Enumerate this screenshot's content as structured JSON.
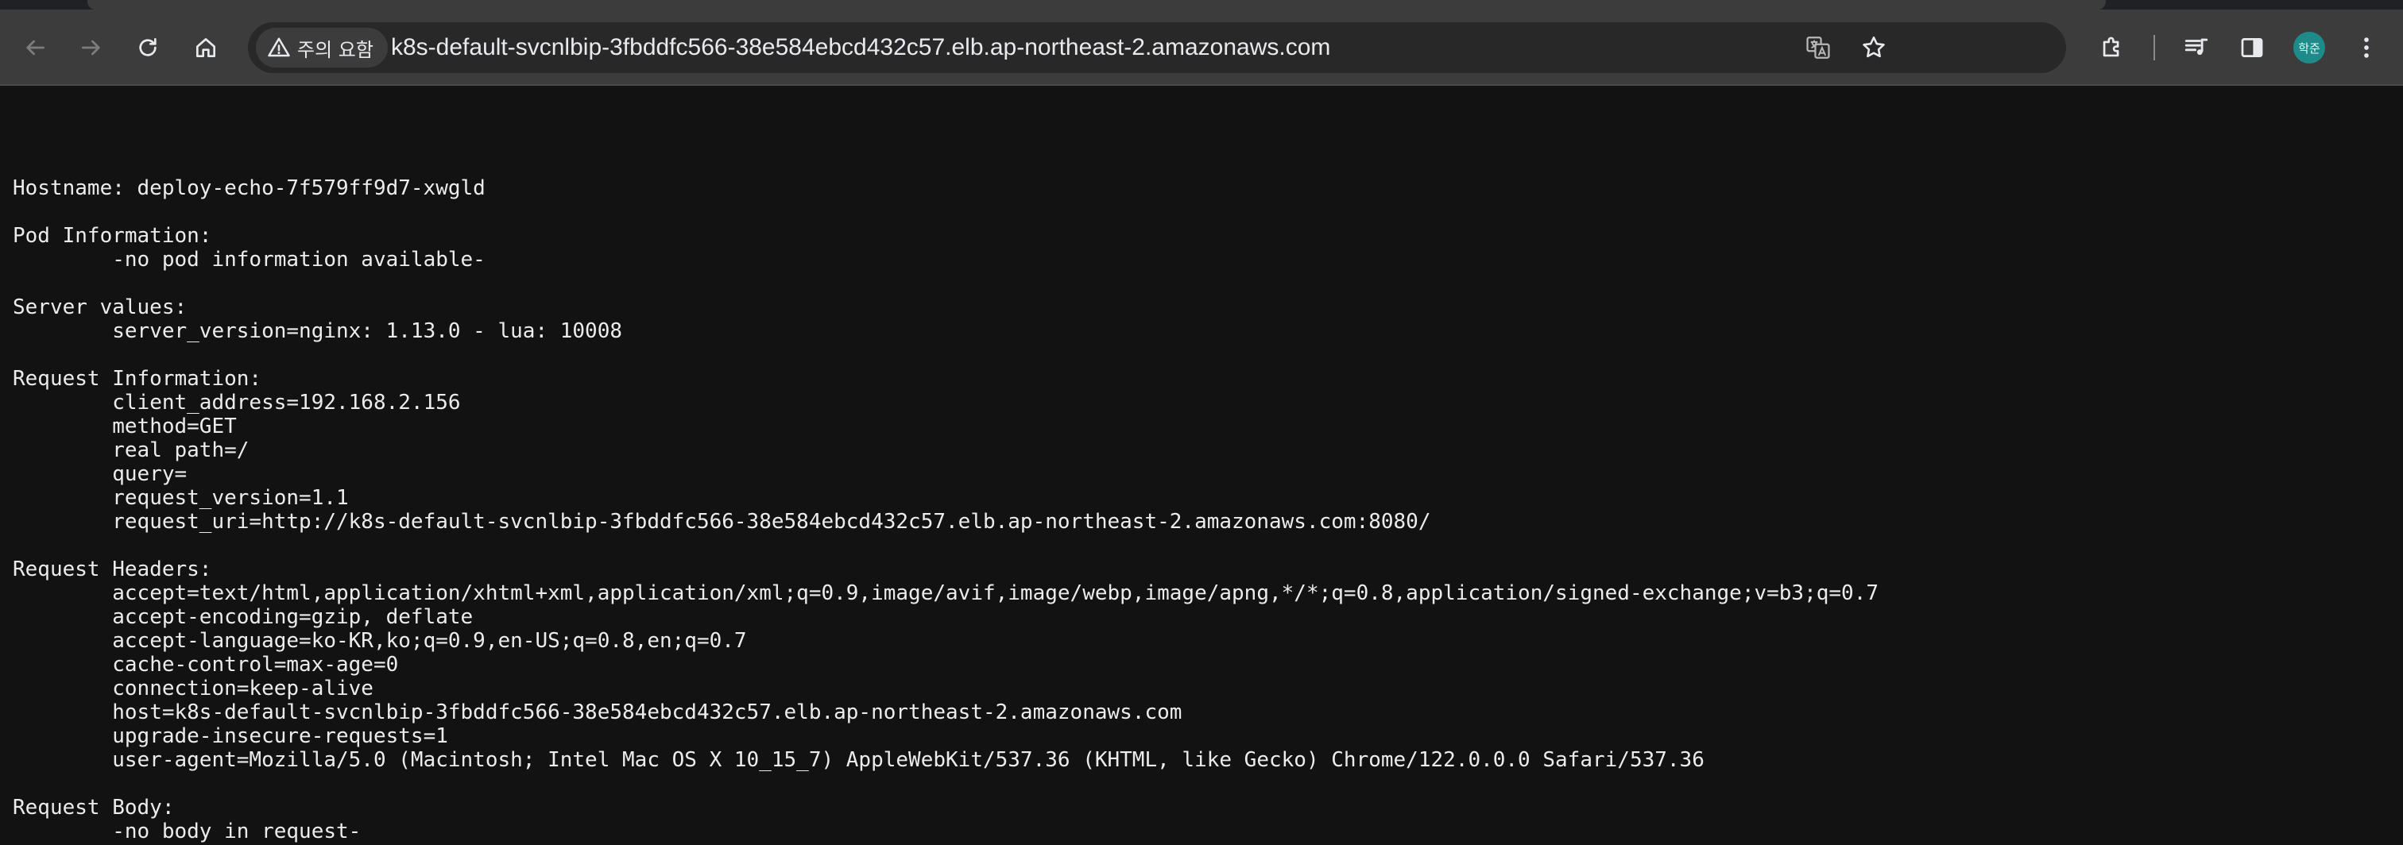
{
  "browser": {
    "security_label": "주의 요함",
    "url": "k8s-default-svcnlbip-3fbddfc566-38e584ebcd432c57.elb.ap-northeast-2.amazonaws.com",
    "profile_initials": "학준",
    "icons": {
      "back": "arrow-left-icon",
      "forward": "arrow-right-icon",
      "reload": "reload-icon",
      "home": "home-icon",
      "warning": "warning-triangle-icon",
      "translate": "translate-icon",
      "bookmark": "star-icon",
      "extensions": "puzzle-icon",
      "reading_list": "queue-music-icon",
      "side_panel": "side-panel-icon",
      "menu": "kebab-menu-icon"
    },
    "colors": {
      "toolbar": "#3c3c3c",
      "omnibox": "#282828",
      "page_background": "#121212",
      "text": "#ececec",
      "avatar": "#1e8a8a"
    }
  },
  "page": {
    "content": "\nHostname: deploy-echo-7f579ff9d7-xwgld\n\nPod Information:\n\t-no pod information available-\n\nServer values:\n\tserver_version=nginx: 1.13.0 - lua: 10008\n\nRequest Information:\n\tclient_address=192.168.2.156\n\tmethod=GET\n\treal path=/\n\tquery=\n\trequest_version=1.1\n\trequest_uri=http://k8s-default-svcnlbip-3fbddfc566-38e584ebcd432c57.elb.ap-northeast-2.amazonaws.com:8080/\n\nRequest Headers:\n\taccept=text/html,application/xhtml+xml,application/xml;q=0.9,image/avif,image/webp,image/apng,*/*;q=0.8,application/signed-exchange;v=b3;q=0.7\n\taccept-encoding=gzip, deflate\n\taccept-language=ko-KR,ko;q=0.9,en-US;q=0.8,en;q=0.7\n\tcache-control=max-age=0\n\tconnection=keep-alive\n\thost=k8s-default-svcnlbip-3fbddfc566-38e584ebcd432c57.elb.ap-northeast-2.amazonaws.com\n\tupgrade-insecure-requests=1\n\tuser-agent=Mozilla/5.0 (Macintosh; Intel Mac OS X 10_15_7) AppleWebKit/537.36 (KHTML, like Gecko) Chrome/122.0.0.0 Safari/537.36\n\nRequest Body:\n\t-no body in request-"
  }
}
